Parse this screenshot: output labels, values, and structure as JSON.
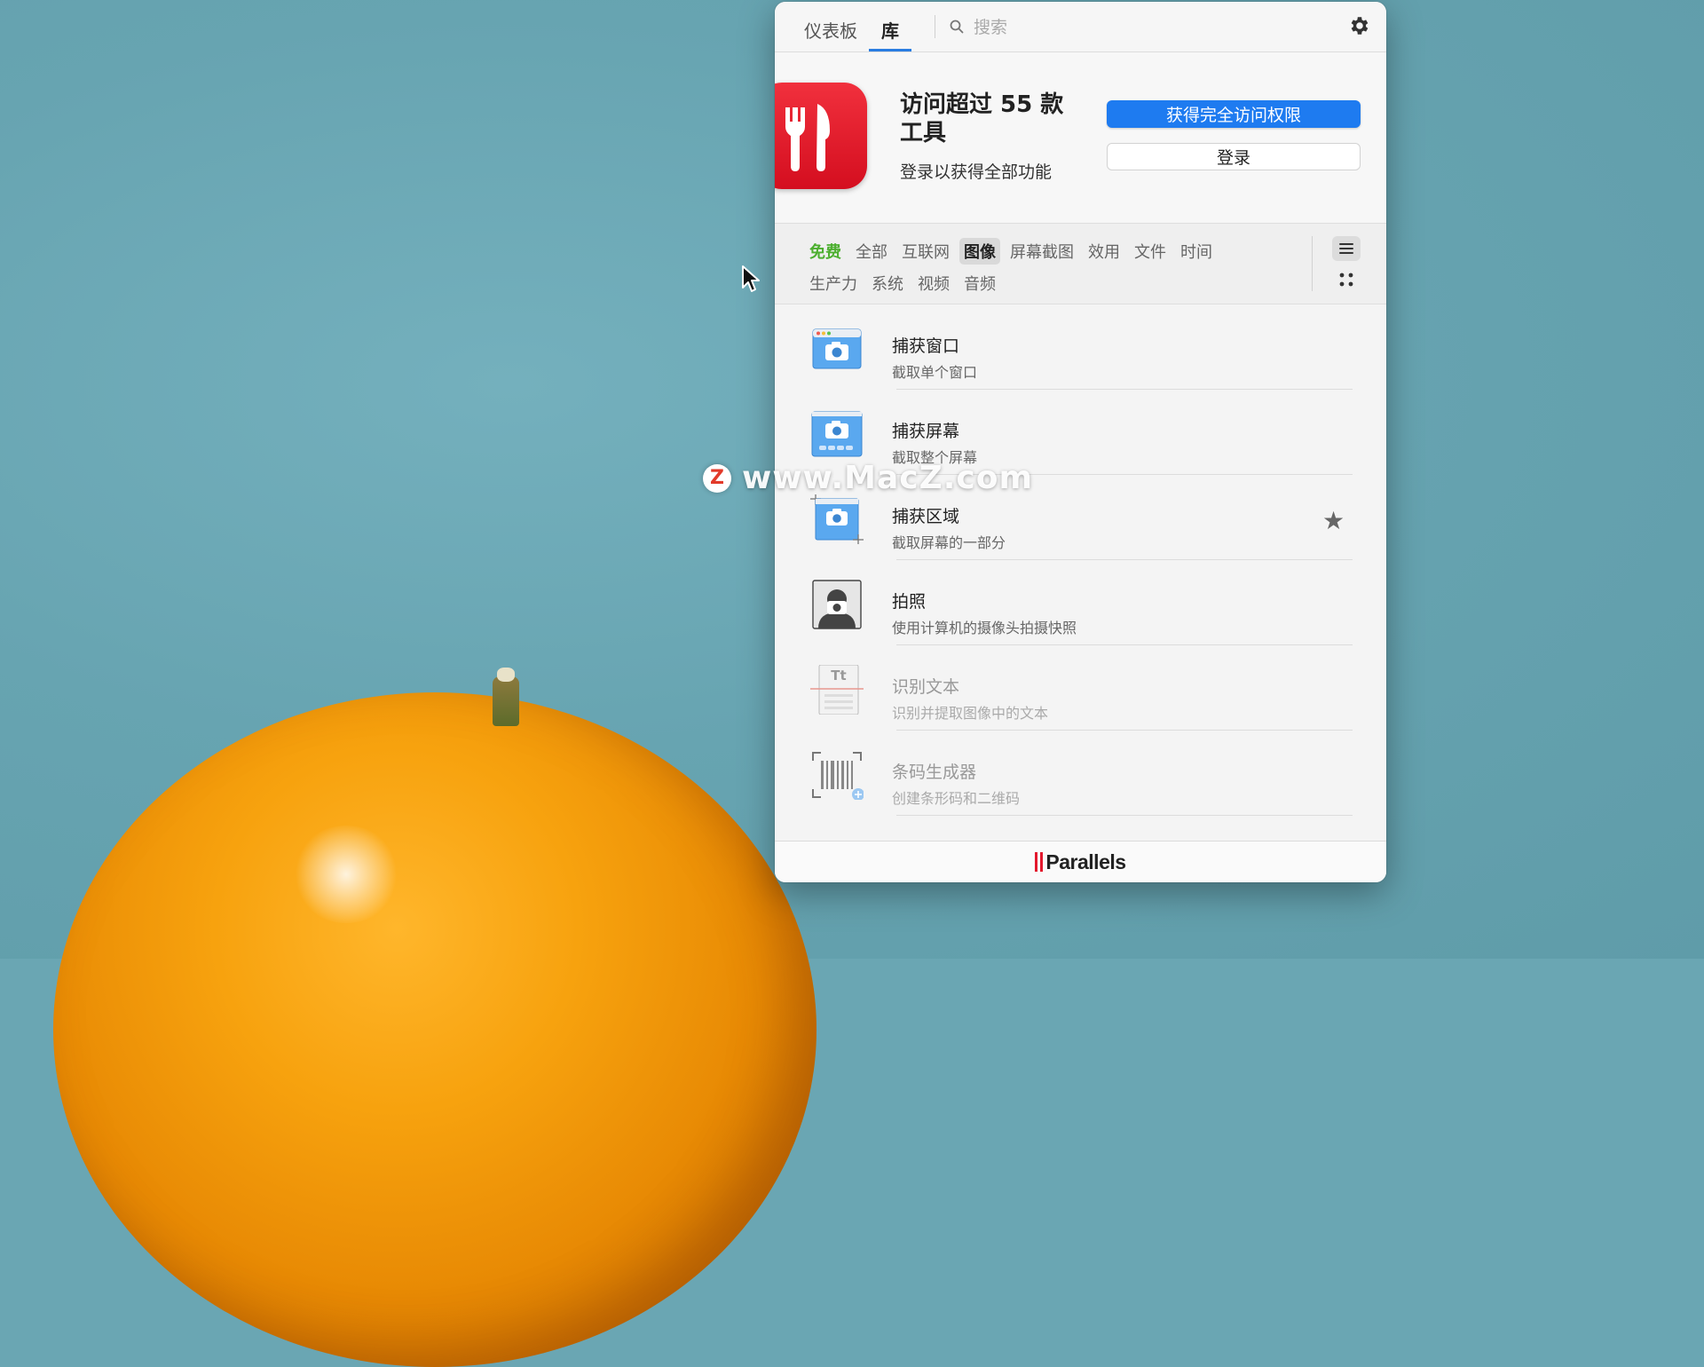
{
  "topbar": {
    "tabs": [
      {
        "label": "仪表板",
        "active": false
      },
      {
        "label": "库",
        "active": true
      }
    ],
    "search_placeholder": "搜索",
    "settings_icon": "gear-icon"
  },
  "promo": {
    "title": "访问超过 55 款工具",
    "subtitle": "登录以获得全部功能",
    "primary_button": "获得完全访问权限",
    "secondary_button": "登录",
    "app_icon": "toolbox-icon",
    "accent_color": "#1e7bf0"
  },
  "categories": {
    "row1": [
      {
        "label": "免费",
        "state": "free"
      },
      {
        "label": "全部",
        "state": "normal"
      },
      {
        "label": "互联网",
        "state": "normal"
      },
      {
        "label": "图像",
        "state": "active"
      },
      {
        "label": "屏幕截图",
        "state": "normal"
      },
      {
        "label": "效用",
        "state": "normal"
      },
      {
        "label": "文件",
        "state": "normal"
      },
      {
        "label": "时间",
        "state": "normal"
      }
    ],
    "row2": [
      {
        "label": "生产力",
        "state": "normal"
      },
      {
        "label": "系统",
        "state": "normal"
      },
      {
        "label": "视频",
        "state": "normal"
      },
      {
        "label": "音频",
        "state": "normal"
      }
    ],
    "view_modes": [
      "list-view-icon",
      "grid-view-icon"
    ],
    "selected_view": "list"
  },
  "tools": [
    {
      "title": "捕获窗口",
      "desc": "截取单个窗口",
      "icon": "capture-window-icon",
      "enabled": true,
      "favorite": false
    },
    {
      "title": "捕获屏幕",
      "desc": "截取整个屏幕",
      "icon": "capture-screen-icon",
      "enabled": true,
      "favorite": false
    },
    {
      "title": "捕获区域",
      "desc": "截取屏幕的一部分",
      "icon": "capture-area-icon",
      "enabled": true,
      "favorite": true
    },
    {
      "title": "拍照",
      "desc": "使用计算机的摄像头拍摄快照",
      "icon": "take-photo-icon",
      "enabled": true,
      "favorite": false
    },
    {
      "title": "识别文本",
      "desc": "识别并提取图像中的文本",
      "icon": "recognize-text-icon",
      "enabled": false,
      "favorite": false
    },
    {
      "title": "条码生成器",
      "desc": "创建条形码和二维码",
      "icon": "barcode-icon",
      "enabled": false,
      "favorite": false
    }
  ],
  "footer": {
    "brand": "Parallels"
  },
  "watermark": {
    "badge": "Z",
    "text": "www.MacZ.com"
  }
}
